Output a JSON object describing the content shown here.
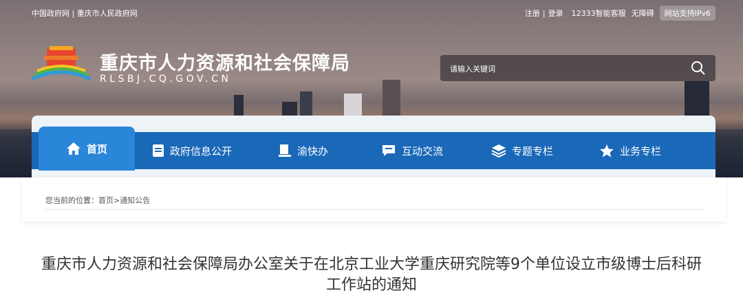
{
  "topbar": {
    "left_links": [
      "中国政府网",
      "|",
      "重庆市人民政府网"
    ],
    "register": "注册",
    "sep": "|",
    "login": "登录",
    "service": "12333智能客服",
    "accessible": "无障碍",
    "ipv6": "网站支持IPv6"
  },
  "header": {
    "site_title": "重庆市人力资源和社会保障局",
    "site_domain": "RLSBJ.CQ.GOV.CN"
  },
  "search": {
    "placeholder": "请输入关键词"
  },
  "nav": {
    "items": [
      {
        "label": "首页",
        "icon": "home-icon"
      },
      {
        "label": "政府信息公开",
        "icon": "document-icon"
      },
      {
        "label": "渝快办",
        "icon": "desk-icon"
      },
      {
        "label": "互动交流",
        "icon": "chat-icon"
      },
      {
        "label": "专题专栏",
        "icon": "layers-icon"
      },
      {
        "label": "业务专栏",
        "icon": "star-icon"
      }
    ]
  },
  "breadcrumb": {
    "prefix": "您当前的位置：",
    "home": "首页",
    "sep": ">",
    "current": "通知公告"
  },
  "article": {
    "title": "重庆市人力资源和社会保障局办公室关于在北京工业大学重庆研究院等9个单位设立市级博士后科研工作站的通知"
  },
  "colors": {
    "nav_blue": "#1a68b8",
    "nav_active": "#2a86d8"
  }
}
